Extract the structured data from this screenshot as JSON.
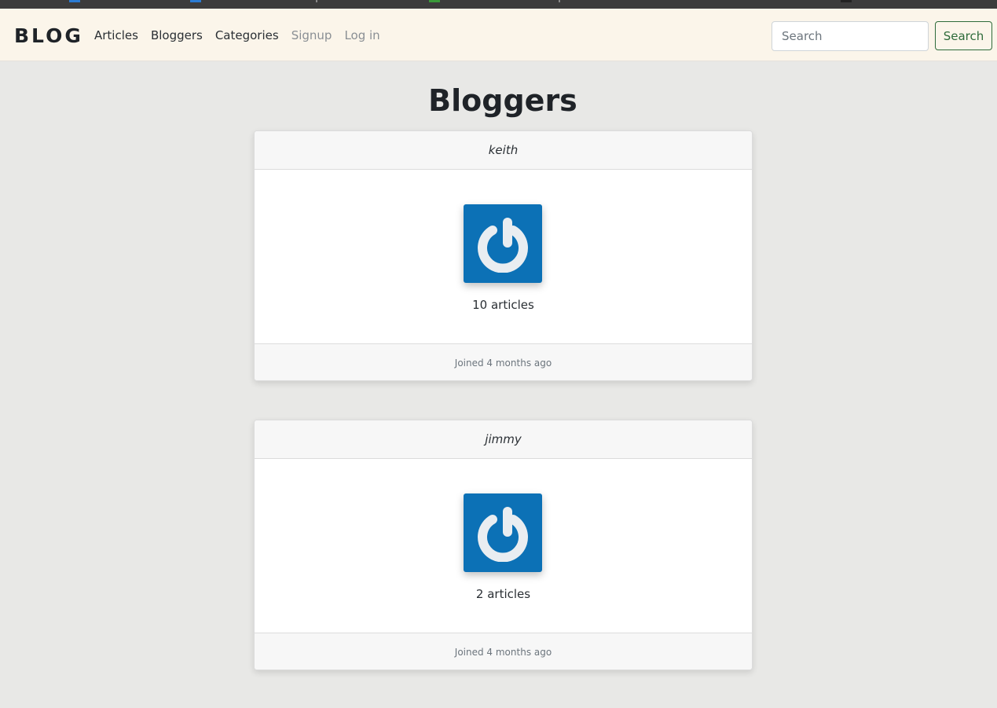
{
  "navbar": {
    "brand": "BLOG",
    "links": [
      {
        "label": "Articles",
        "muted": false
      },
      {
        "label": "Bloggers",
        "muted": false
      },
      {
        "label": "Categories",
        "muted": false
      },
      {
        "label": "Signup",
        "muted": true
      },
      {
        "label": "Log in",
        "muted": true
      }
    ],
    "search_placeholder": "Search",
    "search_button": "Search"
  },
  "page": {
    "title": "Bloggers"
  },
  "bloggers": [
    {
      "username": "keith",
      "avatar_icon": "power-icon",
      "articles": "10 articles",
      "joined": "Joined 4 months ago"
    },
    {
      "username": "jimmy",
      "avatar_icon": "power-icon",
      "articles": "2 articles",
      "joined": "Joined 4 months ago"
    }
  ],
  "colors": {
    "navbar_bg": "#fbf5ea",
    "page_bg": "#e8e8e6",
    "avatar_bg": "#0c71b6",
    "search_button": "#2e6b3a"
  }
}
